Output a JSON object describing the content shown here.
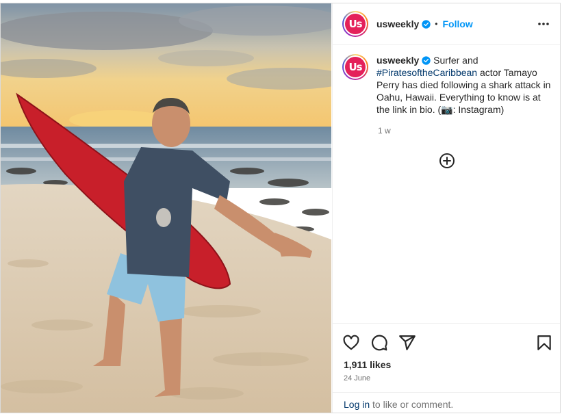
{
  "post": {
    "username": "usweekly",
    "avatar_text": "Us",
    "follow_label": "Follow",
    "separator": "•",
    "caption_username": "usweekly",
    "caption_pre": "Surfer and ",
    "caption_hashtag": "#PiratesoftheCaribbean",
    "caption_post": " actor Tamayo Perry has died following a shark attack in Oahu, Hawaii. Everything to know is at the link in bio. (📷: Instagram)",
    "time_ago": "1 w",
    "likes": "1,911 likes",
    "date": "24 June",
    "login_link": "Log in",
    "login_suffix": " to like or comment."
  },
  "icons": {
    "more": "more-horizontal-icon",
    "verified": "verified-badge-icon",
    "add": "add-circle-icon",
    "like": "heart-icon",
    "comment": "comment-icon",
    "share": "share-icon",
    "save": "bookmark-icon"
  },
  "colors": {
    "link_blue": "#0095f6",
    "hashtag": "#00376b",
    "brand": "#e4215a",
    "muted": "#737373"
  }
}
